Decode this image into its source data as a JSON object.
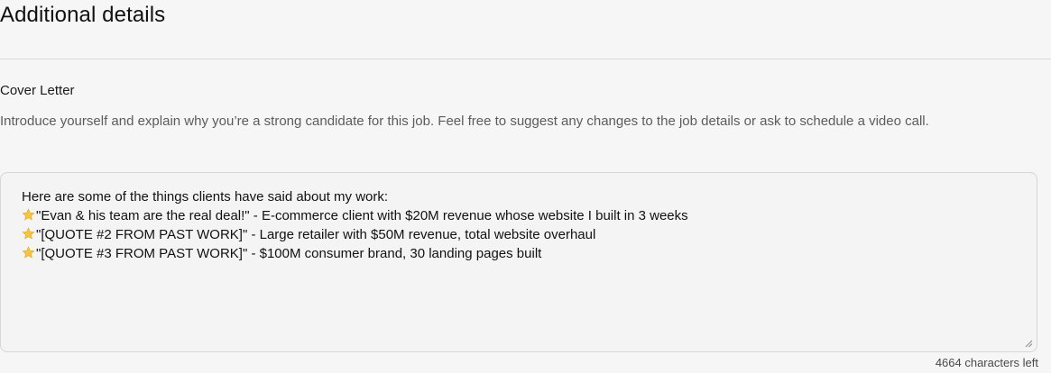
{
  "section": {
    "title": "Additional details"
  },
  "cover_letter": {
    "label": "Cover Letter",
    "help_text": "Introduce yourself and explain why you’re a strong candidate for this job. Feel free to suggest any changes to the job details or ask to schedule a video call.",
    "lines": [
      "Here are some of the things clients have said about my work:",
      "\"Evan & his team are the real deal!\" - E-commerce client with $20M revenue whose website I built in 3 weeks",
      "\"[QUOTE #2 FROM PAST WORK]\" - Large retailer with $50M revenue, total website overhaul",
      "\"[QUOTE #3 FROM PAST WORK]\" - $100M consumer brand, 30 landing pages built"
    ],
    "characters_left": "4664 characters left"
  },
  "colors": {
    "star": "#f5c542",
    "background": "#f6f6f6",
    "border": "#d6d6d6"
  },
  "icons": {
    "star": "star-icon",
    "resize": "resize-handle-icon"
  }
}
